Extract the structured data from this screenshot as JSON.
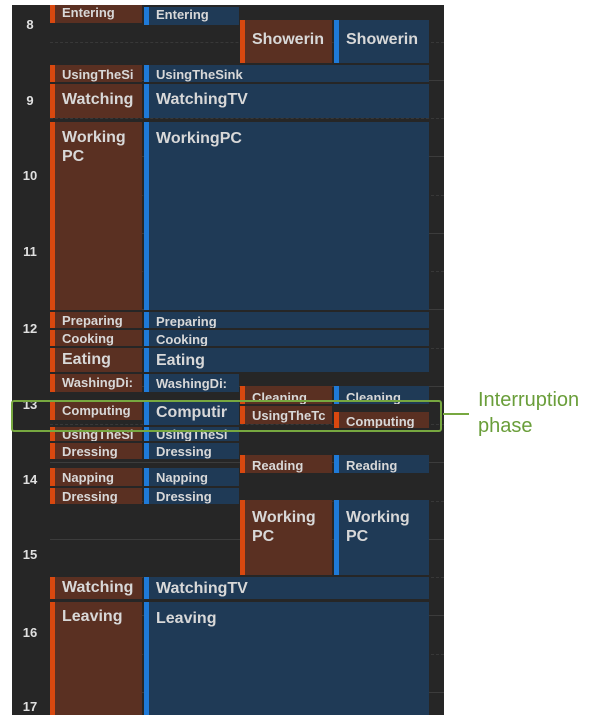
{
  "hours": [
    "8",
    "9",
    "10",
    "11",
    "12",
    "13",
    "14",
    "15",
    "16",
    "17"
  ],
  "annotation": {
    "line1": "Interruption",
    "line2": "phase"
  },
  "colors": {
    "background": "#262626",
    "orange_fill": "#5a3022",
    "orange_bar": "#d9480f",
    "blue_fill": "#1f3a56",
    "blue_bar": "#1f7ad8",
    "highlight": "#77a840"
  },
  "events": {
    "entering_o": "Entering",
    "entering_b": "Entering",
    "showering_o": "Showerin",
    "showering_b": "Showerin",
    "usingsink1_o": "UsingTheSi",
    "usingsink1_b": "UsingTheSink",
    "watching1_o": "Watching",
    "watching1_b": "WatchingTV",
    "working1_o": "Working PC",
    "working1_b": "WorkingPC",
    "preparing_o": "Preparing",
    "preparing_b": "Preparing",
    "cooking_o": "Cooking",
    "cooking_b": "Cooking",
    "eating_o": "Eating",
    "eating_b": "Eating",
    "washing_o": "WashingDi:",
    "washing_b": "WashingDi:",
    "cleaning_o": "Cleaning",
    "cleaning_b": "Cleaning",
    "computing1_o": "Computing",
    "computing1_b": "Computir",
    "usingthe_o": "UsingTheTc",
    "computing2_b": "Computing",
    "usingsink2_o": "UsingTheSi",
    "usingsink2_b": "UsingTheSi",
    "dressing1_o": "Dressing",
    "dressing1_b": "Dressing",
    "reading_o": "Reading",
    "reading_b": "Reading",
    "napping_o": "Napping",
    "napping_b": "Napping",
    "dressing2_o": "Dressing",
    "dressing2_b": "Dressing",
    "working2_o": "Working PC",
    "working2_b": "Working PC",
    "watching2_o": "Watching",
    "watching2_b": "WatchingTV",
    "leaving_o": "Leaving",
    "leaving_b": "Leaving"
  }
}
